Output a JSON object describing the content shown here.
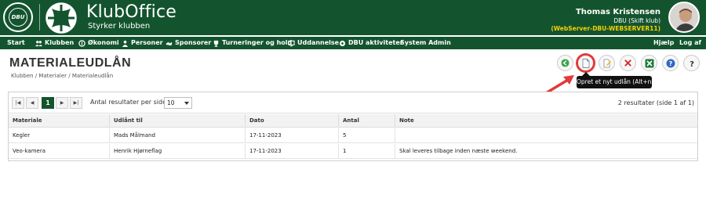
{
  "header": {
    "crest_text": "DBU",
    "crest_ring_text": "DANSK BOLDSPIL-UNION 1889",
    "brand_title": "KlubOffice",
    "brand_subtitle": "Styrker klubben",
    "user_name": "Thomas Kristensen",
    "user_club": "DBU (Skift klub)",
    "user_server": "(WebServer-DBU-WEBSERVER11)",
    "brand_color": "#13542f",
    "server_color": "#f5d000"
  },
  "nav": {
    "items": [
      {
        "label": "Start",
        "icon": ""
      },
      {
        "label": "Klubben",
        "icon": "people-icon"
      },
      {
        "label": "Økonomi",
        "icon": "coin-icon"
      },
      {
        "label": "Personer",
        "icon": "person-icon"
      },
      {
        "label": "Sponsorer",
        "icon": "handshake-icon"
      },
      {
        "label": "Turneringer og hold",
        "icon": "trophy-icon"
      },
      {
        "label": "Uddannelse",
        "icon": "monitor-icon"
      },
      {
        "label": "DBU aktiviteter",
        "icon": "ball-icon"
      },
      {
        "label": "System Admin",
        "icon": ""
      }
    ],
    "help": "Hjælp",
    "logout": "Log af"
  },
  "page": {
    "title": "MATERIALEUDLÅN",
    "breadcrumb": "Klubben / Materialer / Materialeudlån"
  },
  "toolbar": {
    "buttons": [
      "back-icon",
      "new-document-icon",
      "edit-icon",
      "delete-icon",
      "excel-icon",
      "info-icon",
      "help-icon"
    ],
    "tooltip": "Opret et nyt udlån (Alt+n)"
  },
  "grid": {
    "pager": {
      "first": "|◀",
      "prev": "◀",
      "current_page": "1",
      "next": "▶",
      "last": "▶|",
      "per_page_label": "Antal resultater per side",
      "per_page_value": "10"
    },
    "summary": "2 resultater (side 1 af 1)",
    "columns": [
      "Materiale",
      "Udlånt til",
      "Dato",
      "Antal",
      "Note"
    ],
    "rows": [
      [
        "Kegler",
        "Mads Målmand",
        "17-11-2023",
        "5",
        ""
      ],
      [
        "Veo-kamera",
        "Henrik Hjørneflag",
        "17-11-2023",
        "1",
        "Skal leveres tilbage inden næste weekend."
      ]
    ]
  }
}
